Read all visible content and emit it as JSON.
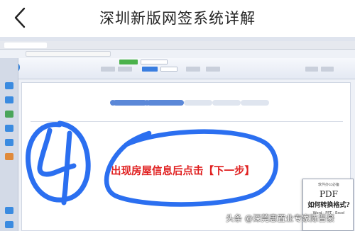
{
  "header": {
    "title": "深圳新版网签系统详解",
    "back_icon": "chevron-left-icon"
  },
  "photo": {
    "step_number": "4",
    "notice_text": "出现房屋信息后点击【下一步】",
    "ink_color": "#2b6ff0",
    "notice_color": "#e02020"
  },
  "pdf_ad": {
    "top_text": "软件办公必备",
    "title": "PDF",
    "subtitle": "如何转换格式?",
    "formats": "Word · PPT · Excel"
  },
  "watermark": {
    "text": "头条 @深莞惠置业专家陈晋豪"
  }
}
